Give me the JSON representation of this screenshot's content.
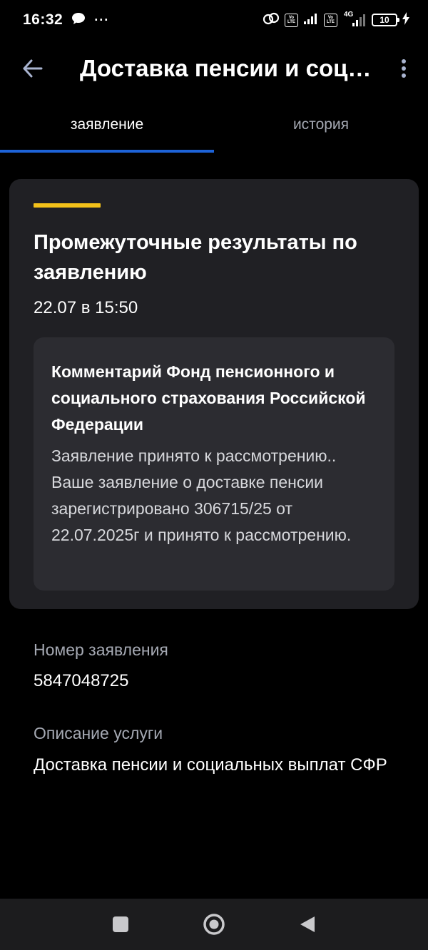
{
  "status_bar": {
    "time": "16:32",
    "dots": "···",
    "lte_label_top": "Vo",
    "lte_label_bottom": "LTE",
    "network_4g": "4G",
    "battery_level": "10",
    "icons": [
      "chat-bubble-icon",
      "more-dots-icon",
      "link-icon",
      "signal-icon",
      "charging-icon"
    ]
  },
  "app_bar": {
    "title": "Доставка пенсии и социальных выплат СФР",
    "back_icon": "arrow-left-icon",
    "menu_icon": "vertical-dots-icon"
  },
  "tabs": [
    {
      "label": "заявление",
      "active": true
    },
    {
      "label": "история",
      "active": false
    }
  ],
  "result_card": {
    "title": "Промежуточные результаты по заявлению",
    "date": "22.07 в 15:50",
    "comment": {
      "title": "Комментарий Фонд пенсионного и социального страхования Российской Федерации",
      "text": "Заявление принято к рассмотрению.. Ваше заявление о доставке пенсии зарегистрировано 306715/25 от 22.07.2025г и принято к рассмотрению."
    }
  },
  "fields": {
    "application_number_label": "Номер заявления",
    "application_number": "5847048725",
    "service_description_label": "Описание услуги",
    "service_description": "Доставка пенсии и социальных выплат СФР"
  },
  "nav_bar": {
    "icons": [
      "recents-square-icon",
      "home-circle-icon",
      "back-triangle-icon"
    ]
  },
  "colors": {
    "background": "#000000",
    "card": "#202024",
    "comment_box": "#2c2c31",
    "accent_yellow": "#f3c11a",
    "tab_indicator": "#1d63d8",
    "muted_text": "#a5a9b3"
  }
}
